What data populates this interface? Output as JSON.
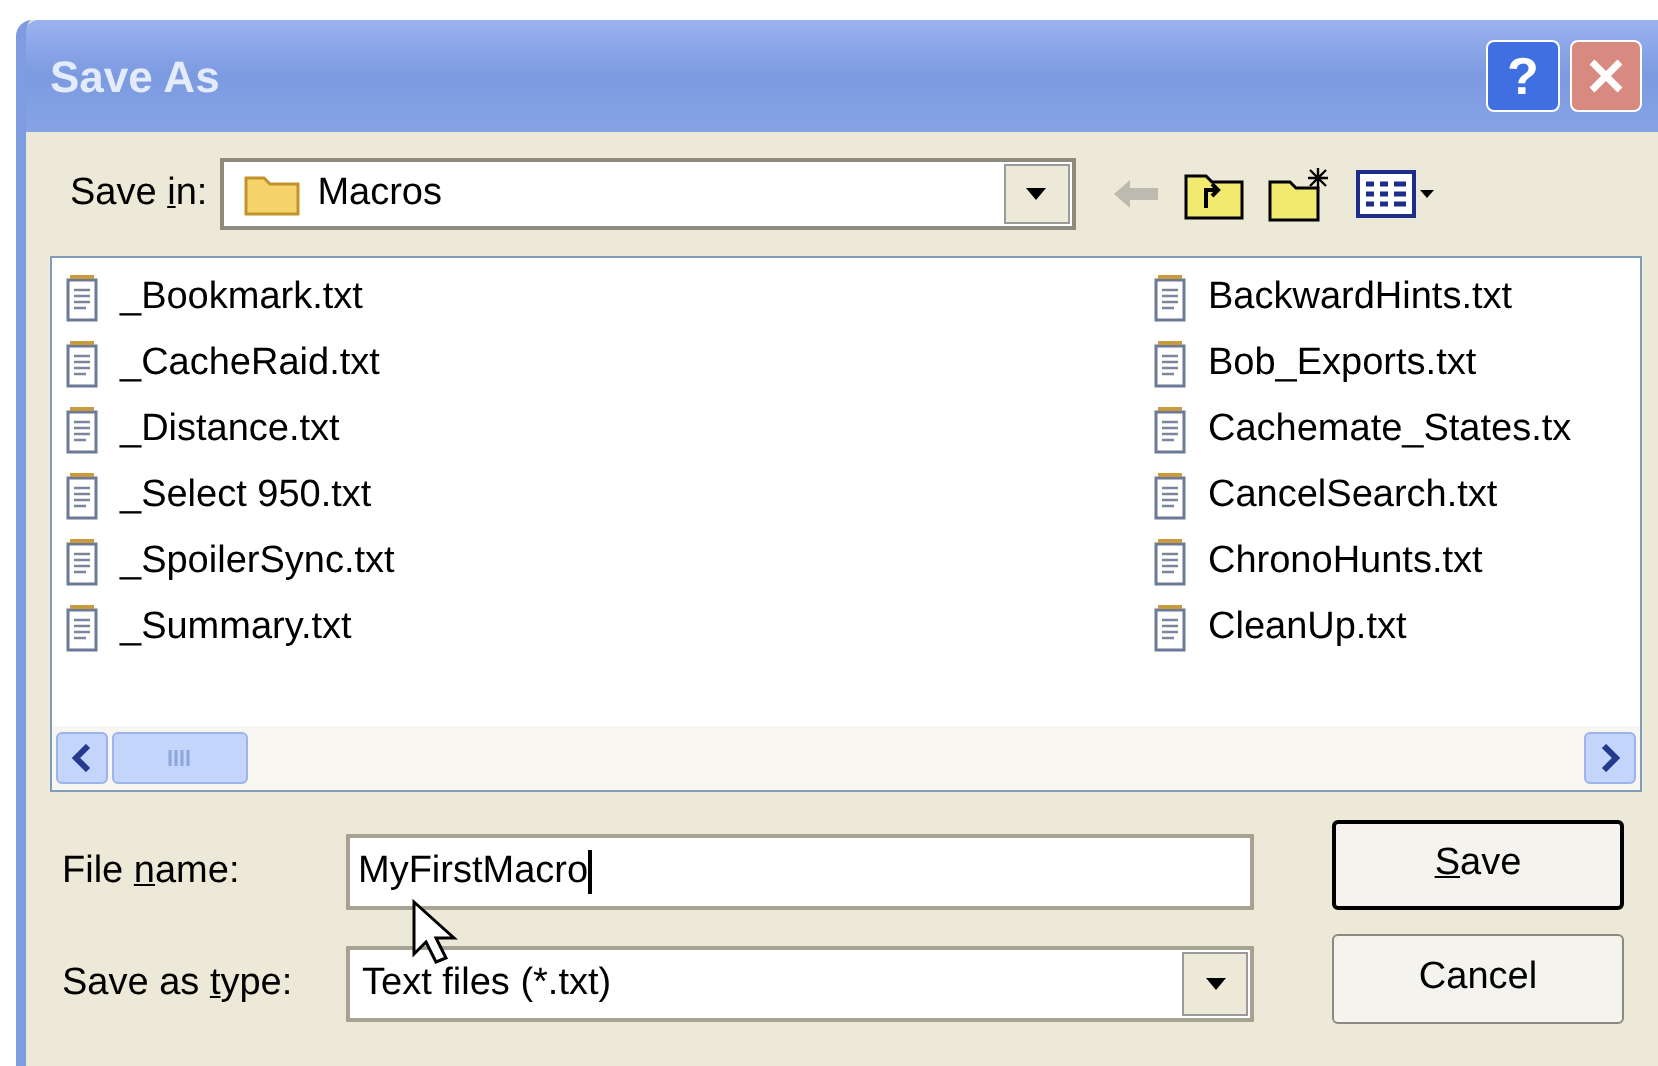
{
  "window": {
    "title": "Save As",
    "help_button": "?"
  },
  "save_in": {
    "label_parts": {
      "before": "Save ",
      "key": "i",
      "after": "n:"
    },
    "value": "Macros"
  },
  "files": [
    {
      "name": "_Bookmark.txt"
    },
    {
      "name": "_CacheRaid.txt"
    },
    {
      "name": "_Distance.txt"
    },
    {
      "name": "_Select 950.txt"
    },
    {
      "name": "_SpoilerSync.txt"
    },
    {
      "name": "_Summary.txt"
    },
    {
      "name": "BackwardHints.txt"
    },
    {
      "name": "Bob_Exports.txt"
    },
    {
      "name": "Cachemate_States.tx"
    },
    {
      "name": "CancelSearch.txt"
    },
    {
      "name": "ChronoHunts.txt"
    },
    {
      "name": "CleanUp.txt"
    }
  ],
  "file_name": {
    "label_parts": {
      "before": "File ",
      "key": "n",
      "after": "ame:"
    },
    "value": "MyFirstMacro"
  },
  "save_as_type": {
    "label_parts": {
      "before": "Save as ",
      "key": "t",
      "after": "ype:"
    },
    "value": "Text files (*.txt)"
  },
  "buttons": [
    {
      "label_parts": {
        "key": "S",
        "after": "ave"
      },
      "default": true
    },
    {
      "label_parts": {
        "before": "Cancel"
      },
      "default": false
    }
  ]
}
